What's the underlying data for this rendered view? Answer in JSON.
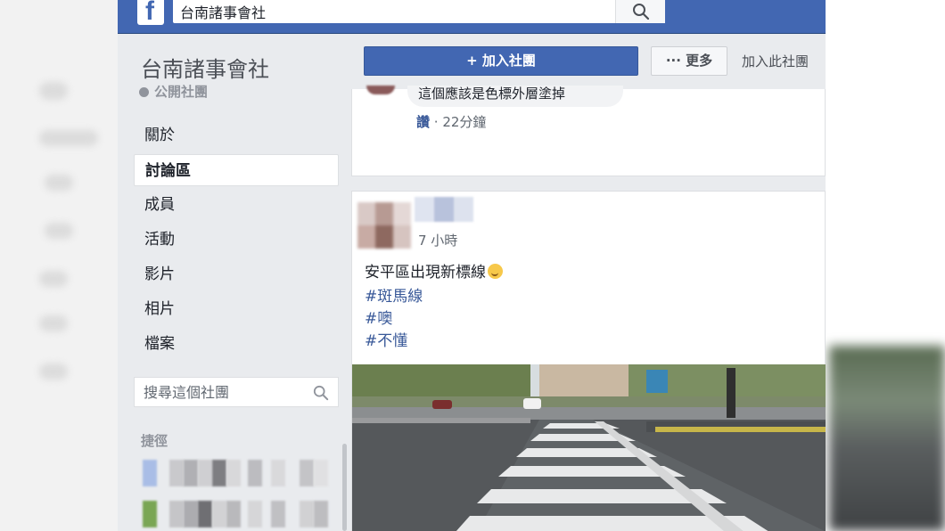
{
  "topbar": {
    "logo": "f",
    "search_value": "台南諸事會社",
    "search_icon": "search-icon"
  },
  "group": {
    "name": "台南諸事會社",
    "type": "公開社團"
  },
  "nav": {
    "items": [
      {
        "label": "關於"
      },
      {
        "label": "討論區",
        "active": true
      },
      {
        "label": "成員"
      },
      {
        "label": "活動"
      },
      {
        "label": "影片"
      },
      {
        "label": "相片"
      },
      {
        "label": "檔案"
      }
    ]
  },
  "group_search": {
    "placeholder": "搜尋這個社團"
  },
  "shortcuts": {
    "title": "捷徑"
  },
  "actions": {
    "join_label": "+ 加入社團",
    "more_label": "··· 更多",
    "join_link": "加入此社團"
  },
  "comment": {
    "text": "這個應該是色標外層塗掉",
    "like_label": "讚",
    "time": "· 22分鐘"
  },
  "post": {
    "time": "7 小時",
    "text": "安平區出現新標線",
    "hashtags": [
      "#斑馬線",
      "#噢",
      "#不懂"
    ]
  },
  "colors": {
    "brand": "#4267b2",
    "link": "#385898",
    "background": "#e9ebee"
  }
}
